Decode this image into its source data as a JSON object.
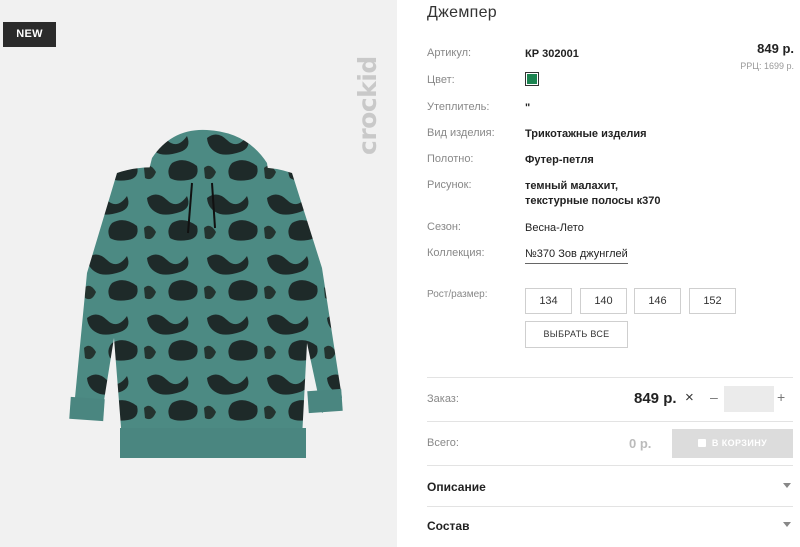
{
  "badge": "NEW",
  "brand": "crockid",
  "product": {
    "title": "Джемпер",
    "price": "849 р.",
    "rrp": "РРЦ: 1699 р."
  },
  "attributes": {
    "article_label": "Артикул:",
    "article_value": "КР 302001",
    "color_label": "Цвет:",
    "color_hex": "#1c8451",
    "insulation_label": "Утеплитель:",
    "insulation_value": "\"",
    "type_label": "Вид изделия:",
    "type_value": "Трикотажные изделия",
    "fabric_label": "Полотно:",
    "fabric_value": "Футер-петля",
    "pattern_label": "Рисунок:",
    "pattern_line1": "темный малахит,",
    "pattern_line2": "текстурные полосы к370",
    "season_label": "Сезон:",
    "season_value": "Весна-Лето",
    "collection_label": "Коллекция:",
    "collection_value": "№370 Зов джунглей"
  },
  "sizes": {
    "label": "Рост/размер:",
    "options": [
      "134",
      "140",
      "146",
      "152"
    ],
    "select_all": "ВЫБРАТЬ ВСЕ"
  },
  "order": {
    "label": "Заказ:",
    "price": "849 р.",
    "times": "×",
    "minus": "–",
    "plus": "+",
    "quantity": ""
  },
  "total": {
    "label": "Всего:",
    "value": "0 р.",
    "cart_button": "В КОРЗИНУ"
  },
  "accordions": [
    "Описание",
    "Состав"
  ]
}
